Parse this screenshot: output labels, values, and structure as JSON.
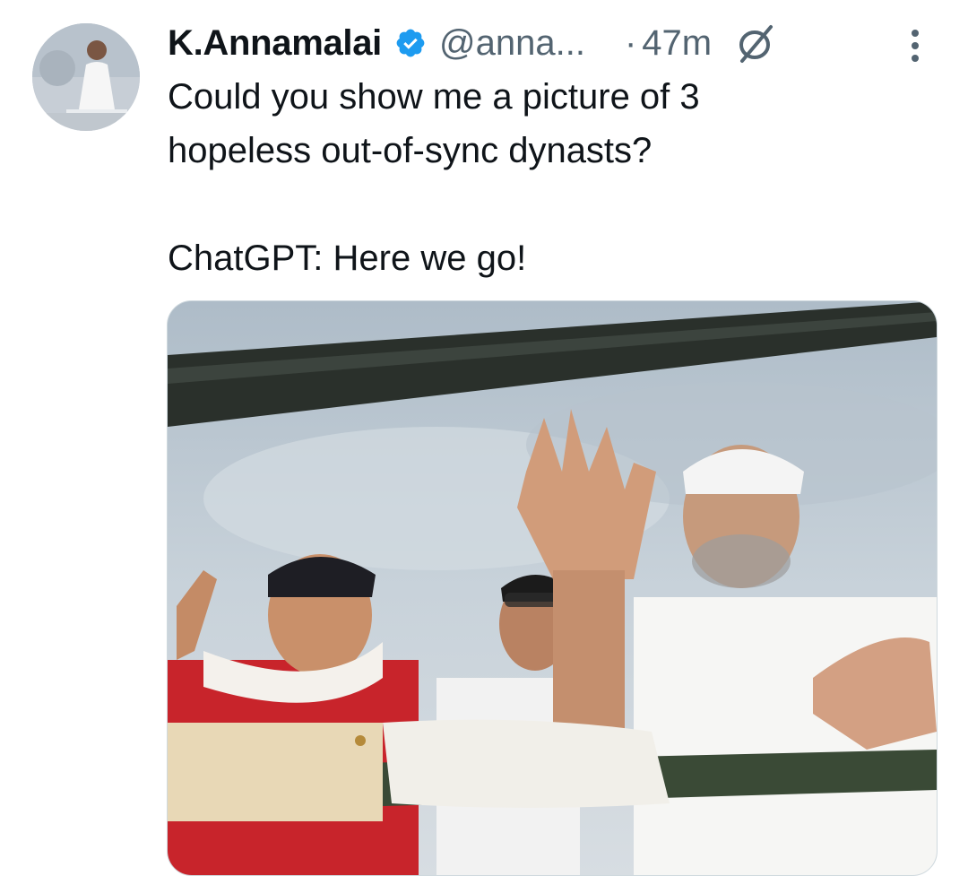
{
  "tweet": {
    "author_name": "K.Annamalai",
    "handle": "@anna...",
    "separator": "·",
    "time_ago": "47m",
    "verified": true,
    "text": "Could you show me a picture of 3\nhopeless out-of-sync dynasts?\n\nChatGPT: Here we go!"
  },
  "icons": {
    "avatar": "profile-avatar",
    "verified": "verified-badge-icon",
    "no_sign": "no-sign-icon",
    "more": "more-options-icon"
  },
  "colors": {
    "verified_blue": "#1d9bf0",
    "secondary_text": "#536471",
    "primary_text": "#0f1419"
  }
}
